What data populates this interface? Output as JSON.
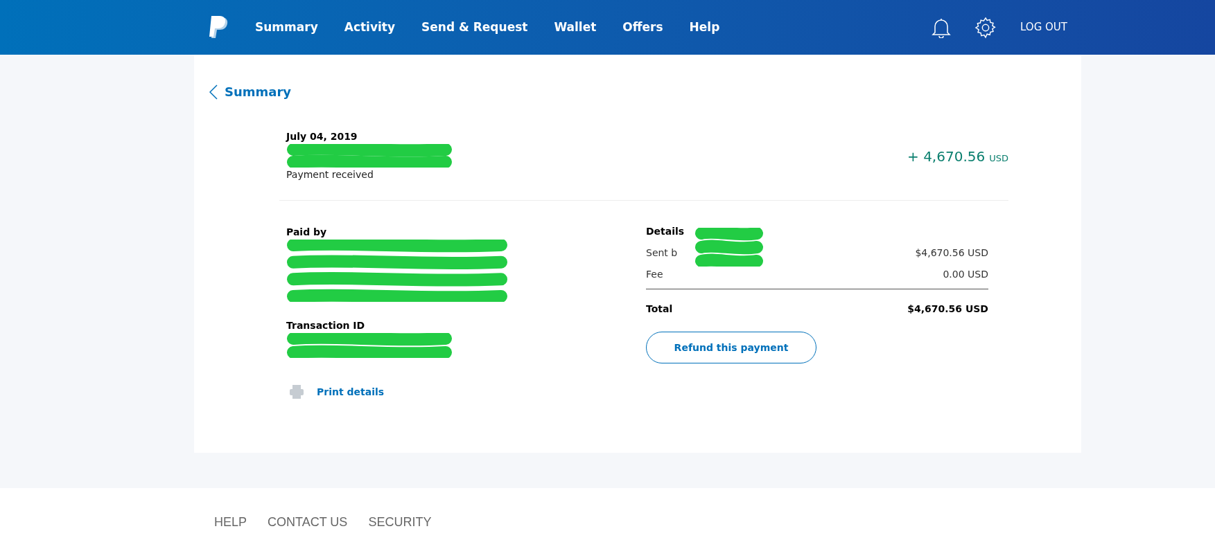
{
  "header": {
    "nav": [
      {
        "label": "Summary"
      },
      {
        "label": "Activity"
      },
      {
        "label": "Send & Request"
      },
      {
        "label": "Wallet"
      },
      {
        "label": "Offers"
      },
      {
        "label": "Help"
      }
    ],
    "logout": "LOG OUT"
  },
  "back_link": "Summary",
  "transaction": {
    "date": "July 04, 2019",
    "status": "Payment received",
    "amount": "+ 4,670.56",
    "currency": "USD"
  },
  "paid_by": {
    "label": "Paid by"
  },
  "transaction_id": {
    "label": "Transaction ID"
  },
  "print": "Print details",
  "details": {
    "title": "Details",
    "rows": [
      {
        "label": "Sent b",
        "value": "$4,670.56 USD"
      },
      {
        "label": "Fee",
        "value": "0.00 USD"
      }
    ],
    "total": {
      "label": "Total",
      "value": "$4,670.56 USD"
    }
  },
  "refund_button": "Refund this payment",
  "footer": [
    "HELP",
    "CONTACT US",
    "SECURITY"
  ]
}
